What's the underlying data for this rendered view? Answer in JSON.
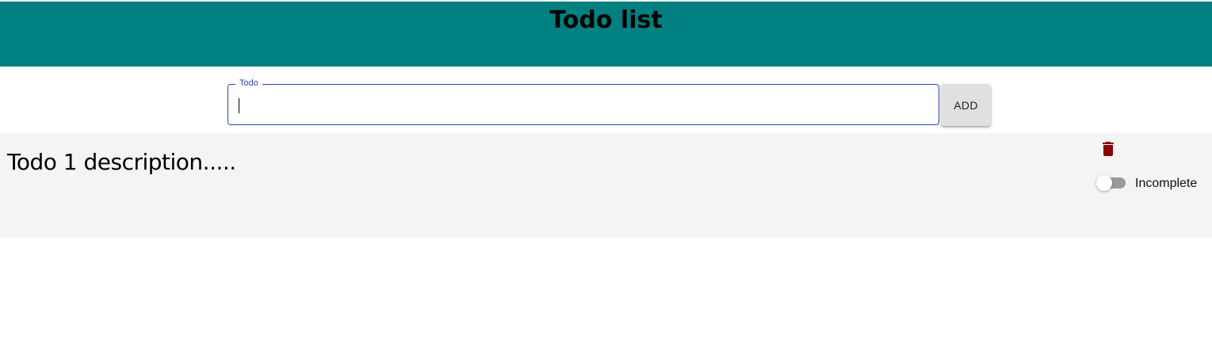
{
  "header": {
    "title": "Todo list",
    "background_color": "#008080"
  },
  "form": {
    "field_label": "Todo",
    "input_value": "",
    "add_label": "ADD",
    "focus_color": "#2d46b9"
  },
  "todos": [
    {
      "description": "Todo 1 description.....",
      "delete_icon": "trash-icon",
      "delete_color": "#8b0000",
      "completed": false,
      "status_label": "Incomplete"
    }
  ]
}
